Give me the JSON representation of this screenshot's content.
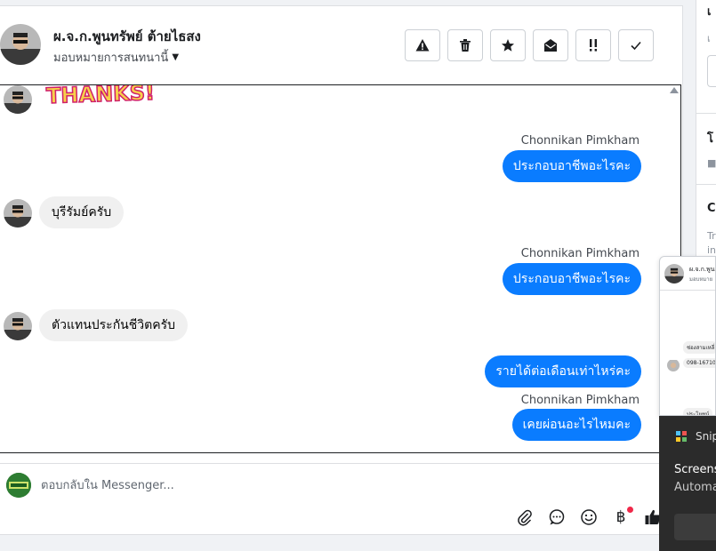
{
  "conversation": {
    "contact_name": "ผ.จ.ก.พูนทรัพย์ ต้ายไธสง",
    "assign_label": "มอบหมายการสนทนานี้"
  },
  "toolbar": {
    "buttons": [
      {
        "name": "report-button",
        "icon": "warning-icon"
      },
      {
        "name": "delete-button",
        "icon": "trash-icon"
      },
      {
        "name": "star-button",
        "icon": "star-icon"
      },
      {
        "name": "mark-unread-button",
        "icon": "envelope-open-icon"
      },
      {
        "name": "follow-up-button",
        "icon": "exclamation-icon"
      },
      {
        "name": "mark-done-button",
        "icon": "check-icon"
      }
    ]
  },
  "messages": {
    "sticker_text": "THANKS!",
    "items": [
      {
        "sender": "Chonnikan Pimkham",
        "text": "ประกอบอาชีพอะไรคะ"
      },
      {
        "text": "บุรีรัมย์ครับ"
      },
      {
        "sender": "Chonnikan Pimkham",
        "text": "ประกอบอาชีพอะไรคะ"
      },
      {
        "text": "ตัวแทนประกันชีวิตครับ"
      },
      {
        "text": "รายได้ต่อเดือนเท่าไหร่คะ"
      },
      {
        "sender": "Chonnikan Pimkham",
        "text": "เคยผ่อนอะไรไหมคะ"
      }
    ]
  },
  "composer": {
    "placeholder": "ตอบกลับใน Messenger...",
    "currency_symbol": "฿"
  },
  "side": {
    "t1": "เ",
    "t2": "เ",
    "t3": "โ",
    "t4": "C",
    "t5": "Tr",
    "t6": "in"
  },
  "preview": {
    "title": "ผ.จ.ก.พูน",
    "subtitle": "มอบหมาย",
    "bubble1": "ช่องสามเหลี่",
    "bubble2": "098-16710",
    "bubble3": "ประโยชน์"
  },
  "toast": {
    "app": "Snip",
    "title": "Screens",
    "body": "Automa"
  },
  "colors": {
    "accent": "#0a7cff",
    "incoming_bubble": "#f0f0f0"
  }
}
